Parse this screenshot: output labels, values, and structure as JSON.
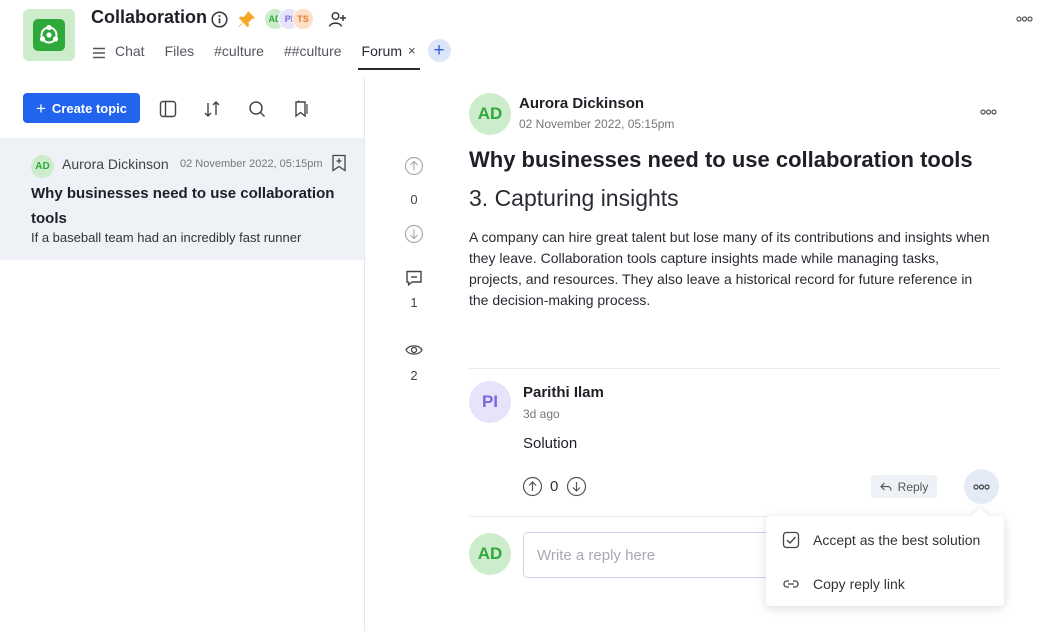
{
  "header": {
    "title": "Collaboration",
    "avatars": [
      {
        "initials": "AD",
        "bg": "#cdeccb",
        "fg": "#2eaa3a"
      },
      {
        "initials": "PI",
        "bg": "#e6e3fb",
        "fg": "#7a6ad8"
      },
      {
        "initials": "TS",
        "bg": "#fde0c8",
        "fg": "#e07a2e"
      }
    ],
    "tabs": [
      {
        "label": "Chat"
      },
      {
        "label": "Files"
      },
      {
        "label": "#culture"
      },
      {
        "label": "##culture"
      },
      {
        "label": "Forum",
        "active": true,
        "close": "×"
      }
    ],
    "add_tab": "+"
  },
  "sidebar": {
    "create_button": "Create topic",
    "topic": {
      "avatar": "AD",
      "author": "Aurora Dickinson",
      "date": "02 November 2022, 05:15pm",
      "title": "Why businesses need to use collaboration tools",
      "snippet": "If a baseball team had an incredibly fast runner"
    }
  },
  "post": {
    "avatar": "AD",
    "author": "Aurora Dickinson",
    "date": "02 November 2022, 05:15pm",
    "title": "Why businesses need to use collaboration tools",
    "subtitle": "3. Capturing insights",
    "body": "A company can hire great talent but lose many of its contributions and insights when they leave. Collaboration tools capture insights made while managing tasks, projects, and resources. They also leave a historical record for future reference in the decision-making process.",
    "votes": "0",
    "comments": "1",
    "views": "2"
  },
  "reply": {
    "avatar": "PI",
    "author": "Parithi Ilam",
    "time": "3d ago",
    "text": "Solution",
    "votes": "0",
    "reply_label": "Reply"
  },
  "composer": {
    "avatar": "AD",
    "placeholder": "Write a reply here"
  },
  "menu": {
    "items": [
      {
        "label": "Accept as the best solution",
        "icon": "check-square-icon"
      },
      {
        "label": "Copy reply link",
        "icon": "link-icon"
      }
    ]
  },
  "colors": {
    "accent": "#2364ee",
    "brand_green": "#2eaa3a",
    "pin": "#f5a623"
  }
}
